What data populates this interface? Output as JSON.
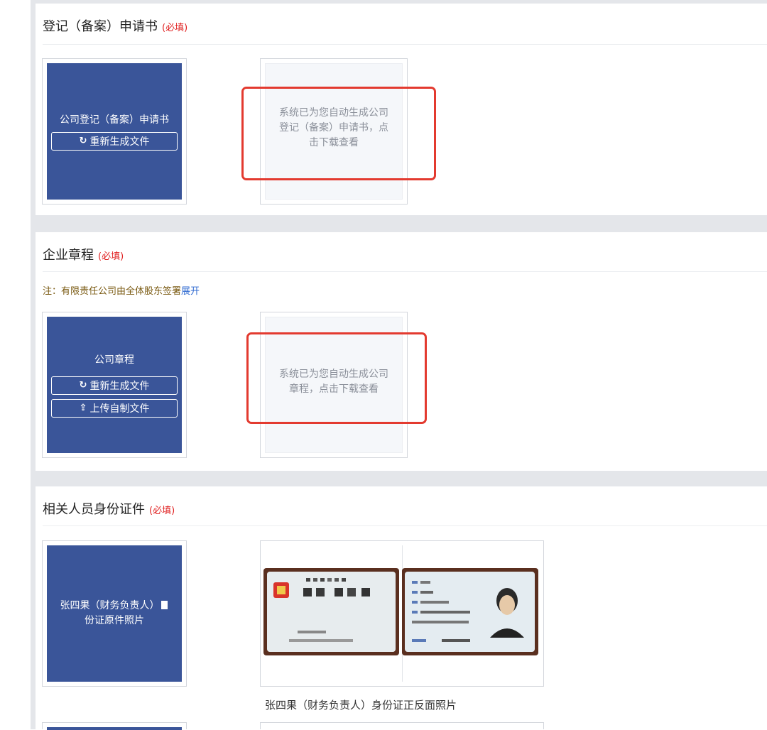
{
  "sections": [
    {
      "title": "登记（备案）申请书",
      "required": "(必填)",
      "card": {
        "title": "公司登记（备案）申请书",
        "regenerate": "重新生成文件"
      },
      "preview": {
        "text": "系统已为您自动生成公司登记（备案）申请书，点击下载查看"
      }
    },
    {
      "title": "企业章程",
      "required": "(必填)",
      "note": {
        "text": "注：有限责任公司由全体股东签署",
        "link": "展开"
      },
      "card": {
        "title": "公司章程",
        "regenerate": "重新生成文件",
        "upload": "上传自制文件"
      },
      "preview": {
        "text": "系统已为您自动生成公司章程，点击下载查看"
      }
    },
    {
      "title": "相关人员身份证件",
      "required": "(必填)",
      "card": {
        "title_a": "张四果（财务负责人）",
        "title_b": "份证原件照片"
      },
      "caption": "张四果（财务负责人）身份证正反面照片"
    }
  ],
  "icons": {
    "refresh": "refresh-icon",
    "upload": "upload-icon",
    "file": "file-icon"
  },
  "colors": {
    "card_bg": "#3a5599",
    "highlight": "#e33a2f",
    "required": "#e02020",
    "link": "#2f6ad0",
    "note": "#7a5a12"
  }
}
